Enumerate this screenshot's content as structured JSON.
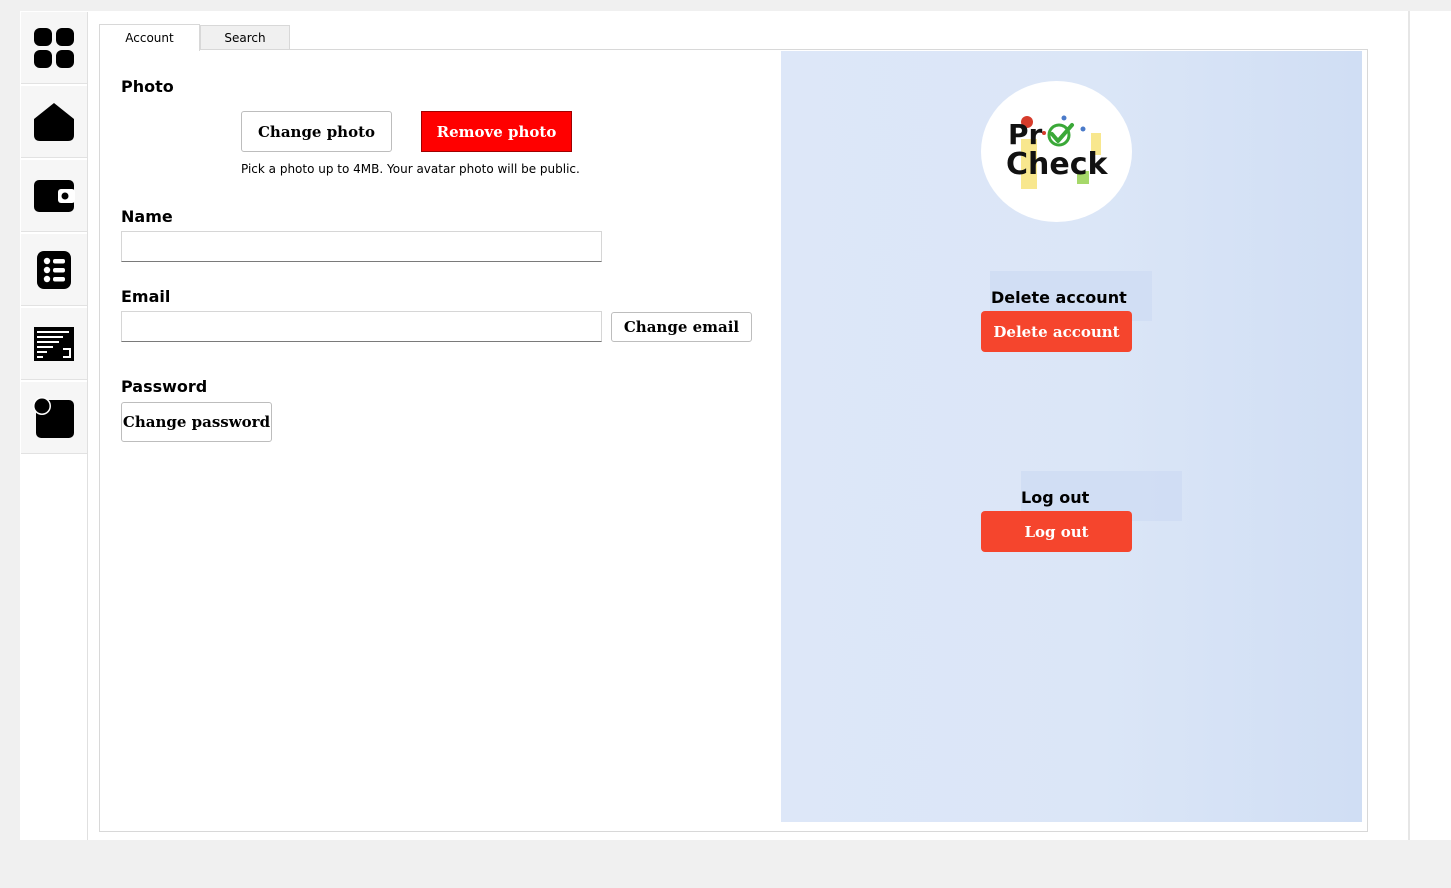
{
  "sidebar": {
    "items": [
      {
        "icon": "grid-icon"
      },
      {
        "icon": "home-icon"
      },
      {
        "icon": "wallet-icon"
      },
      {
        "icon": "checklist-icon"
      },
      {
        "icon": "ledger-icon"
      },
      {
        "icon": "notification-icon"
      }
    ]
  },
  "tabs": [
    {
      "label": "Account",
      "active": true
    },
    {
      "label": "Search",
      "active": false
    }
  ],
  "account": {
    "photo": {
      "label": "Photo",
      "change_label": "Change photo",
      "remove_label": "Remove photo",
      "hint": "Pick a photo up to 4MB. Your avatar photo will be public."
    },
    "name": {
      "label": "Name",
      "value": "",
      "placeholder": ""
    },
    "email": {
      "label": "Email",
      "value": "",
      "placeholder": "",
      "change_label": "Change email"
    },
    "password": {
      "label": "Password",
      "change_label": "Change password"
    }
  },
  "panel": {
    "logo": {
      "line1_pre": "Pr",
      "line2": "Check"
    },
    "delete": {
      "label": "Delete account",
      "button": "Delete account"
    },
    "logout": {
      "label": "Log out",
      "button": "Log out"
    }
  },
  "colors": {
    "remove": "#ff0000",
    "danger": "#f5452d",
    "panel": "#dbe6f7",
    "logo_check": "#3aa838"
  }
}
